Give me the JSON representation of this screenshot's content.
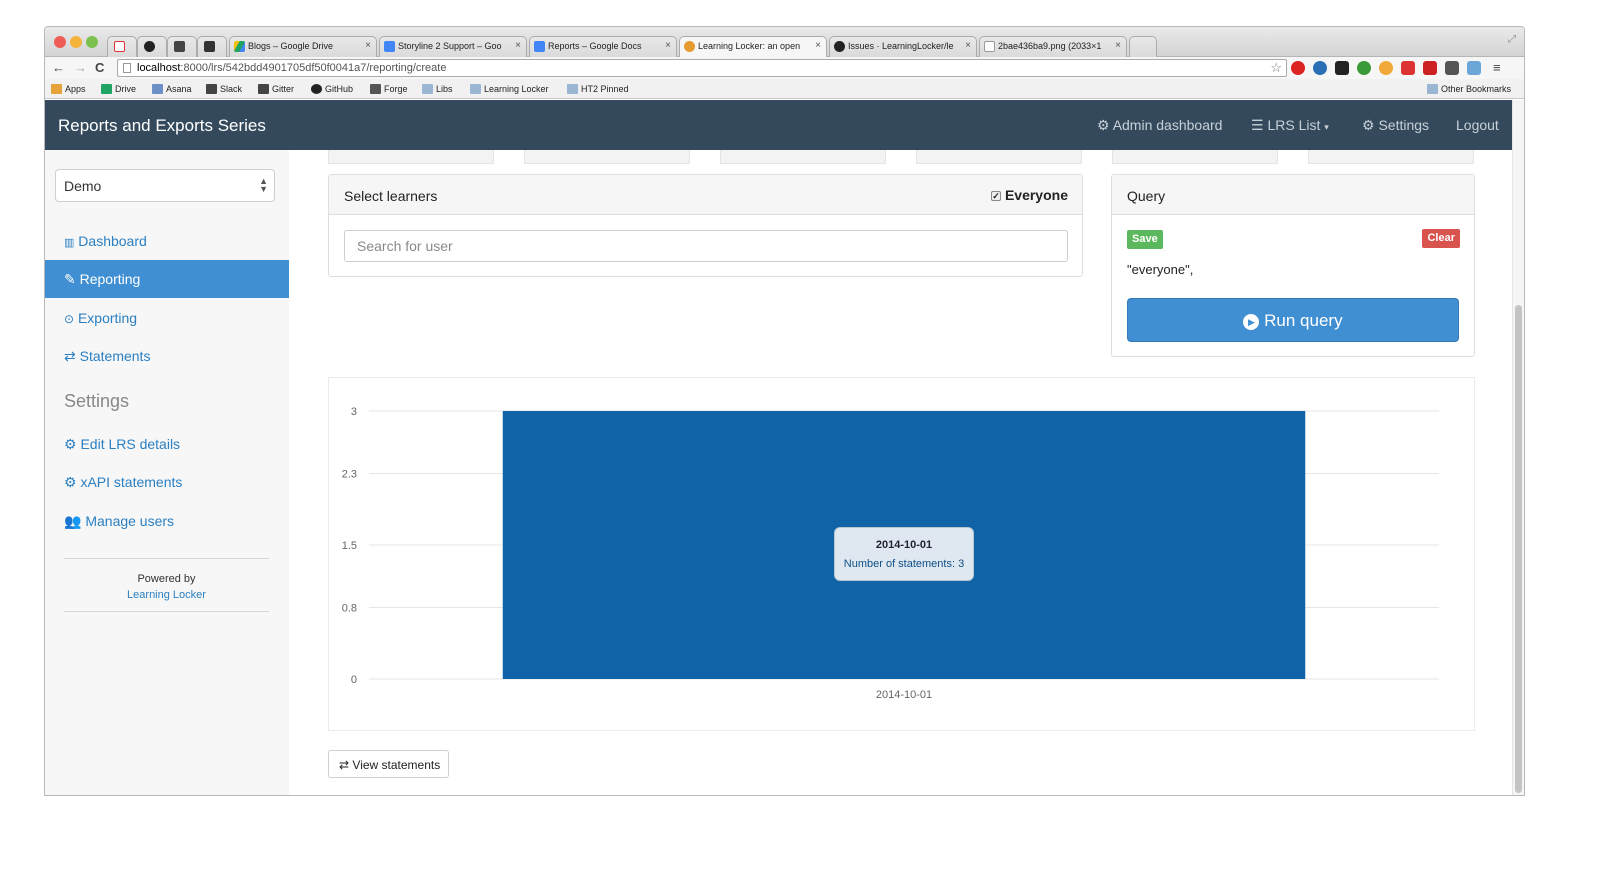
{
  "browser": {
    "tabs": [
      {
        "label": "",
        "icon": "gmail-icon"
      },
      {
        "label": "",
        "icon": "github-icon"
      },
      {
        "label": "",
        "icon": "slack-icon"
      },
      {
        "label": "",
        "icon": "gitter-icon"
      },
      {
        "label": "Blogs – Google Drive",
        "icon": "drive-icon"
      },
      {
        "label": "Storyline 2 Support – Goo",
        "icon": "docs-icon"
      },
      {
        "label": "Reports – Google Docs",
        "icon": "docs-icon"
      },
      {
        "label": "Learning Locker: an open",
        "icon": "learning-locker-icon"
      },
      {
        "label": "Issues · LearningLocker/le",
        "icon": "github-icon"
      },
      {
        "label": "2bae436ba9.png (2033×1",
        "icon": "page-icon"
      }
    ],
    "url_host": "localhost",
    "url_path": ":8000/lrs/542bdd4901705df50f0041a7/reporting/create",
    "bookmarks": [
      "Apps",
      "Drive",
      "Asana",
      "Slack",
      "Gitter",
      "GitHub",
      "Forge",
      "Libs",
      "Learning Locker",
      "HT2 Pinned"
    ],
    "other_bookmarks": "Other Bookmarks"
  },
  "header": {
    "brand": "Reports and Exports Series",
    "admin": "Admin dashboard",
    "lrs_list": "LRS List",
    "settings": "Settings",
    "logout": "Logout"
  },
  "sidebar": {
    "lrs_select": "Demo",
    "nav": [
      {
        "label": "Dashboard",
        "icon": "bar-chart-icon"
      },
      {
        "label": "Reporting",
        "icon": "pencil-icon"
      },
      {
        "label": "Exporting",
        "icon": "circle-arrow-icon"
      },
      {
        "label": "Statements",
        "icon": "exchange-icon"
      }
    ],
    "settings_heading": "Settings",
    "settings": [
      {
        "label": "Edit LRS details",
        "icon": "gear-icon"
      },
      {
        "label": "xAPI statements",
        "icon": "gears-icon"
      },
      {
        "label": "Manage users",
        "icon": "users-icon"
      }
    ],
    "powered_by": "Powered by",
    "powered_link": "Learning Locker"
  },
  "learners": {
    "title": "Select learners",
    "everyone_label": "Everyone",
    "everyone_checked": true,
    "search_placeholder": "Search for user"
  },
  "query": {
    "title": "Query",
    "save": "Save",
    "clear": "Clear",
    "text": "\"everyone\",",
    "run": "Run query"
  },
  "view_statements": "View statements",
  "colors": {
    "bar": "#0f63a6",
    "primary": "#3f8fd2",
    "save": "#5cb85c",
    "clear": "#d9534f",
    "navbar": "#344a5c"
  },
  "chart_data": {
    "type": "bar",
    "categories": [
      "2014-10-01"
    ],
    "values": [
      3
    ],
    "ylim": [
      0,
      3
    ],
    "yticks": [
      "0",
      "0.8",
      "1.5",
      "2.3",
      "3"
    ],
    "tooltip": {
      "title": "2014-10-01",
      "text": "Number of statements: 3"
    },
    "grid": true,
    "legend": "none"
  }
}
